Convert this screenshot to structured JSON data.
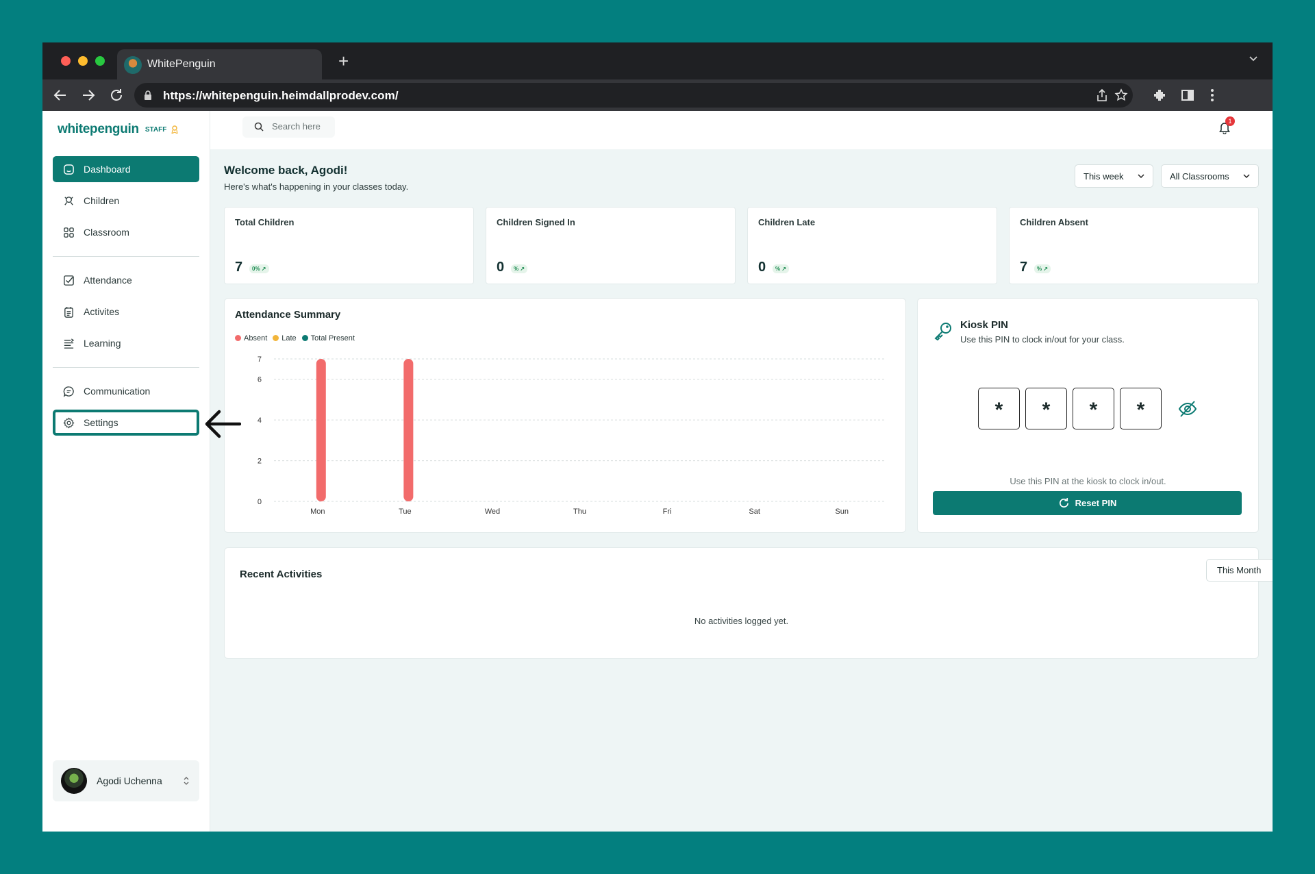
{
  "browser": {
    "tab_title": "WhitePenguin",
    "url": "https://whitepenguin.heimdallprodev.com/"
  },
  "sidebar": {
    "logo": "whitepenguin",
    "logo_tag": "STAFF",
    "items": [
      {
        "label": "Dashboard"
      },
      {
        "label": "Children"
      },
      {
        "label": "Classroom"
      },
      {
        "label": "Attendance"
      },
      {
        "label": "Activites"
      },
      {
        "label": "Learning"
      },
      {
        "label": "Communication"
      },
      {
        "label": "Settings"
      }
    ],
    "user_name": "Agodi Uchenna"
  },
  "header": {
    "search_placeholder": "Search here",
    "notification_count": "1"
  },
  "main": {
    "welcome": "Welcome back, Agodi!",
    "subtitle": "Here's what's happening in your classes today.",
    "period_select": "This week",
    "classroom_select": "All Classrooms",
    "stats": [
      {
        "label": "Total Children",
        "value": "7",
        "change": "0% ↗"
      },
      {
        "label": "Children Signed In",
        "value": "0",
        "change": "% ↗"
      },
      {
        "label": "Children Late",
        "value": "0",
        "change": "% ↗"
      },
      {
        "label": "Children Absent",
        "value": "7",
        "change": "% ↗"
      }
    ],
    "kiosk": {
      "title": "Kiosk PIN",
      "subtitle": "Use this PIN to clock in/out for your class.",
      "pin_digits": [
        "*",
        "*",
        "*",
        "*"
      ],
      "hint": "Use this PIN at the kiosk to clock in/out.",
      "reset_label": "Reset PIN"
    },
    "recent": {
      "title": "Recent Activities",
      "filter": "This Month",
      "empty": "No activities logged yet."
    }
  },
  "colors": {
    "brand": "#0c7a72",
    "absent": "#f26b6b",
    "late": "#f2b53a",
    "present": "#0c7a72"
  },
  "chart_data": {
    "type": "bar",
    "title": "Attendance Summary",
    "categories": [
      "Mon",
      "Tue",
      "Wed",
      "Thu",
      "Fri",
      "Sat",
      "Sun"
    ],
    "series": [
      {
        "name": "Absent",
        "values": [
          7,
          7,
          0,
          0,
          0,
          0,
          0
        ]
      },
      {
        "name": "Late",
        "values": [
          0,
          0,
          0,
          0,
          0,
          0,
          0
        ]
      },
      {
        "name": "Total Present",
        "values": [
          0,
          0,
          0,
          0,
          0,
          0,
          0
        ]
      }
    ],
    "yticks": [
      0,
      2,
      4,
      6,
      7
    ],
    "ylim": [
      0,
      7
    ],
    "legend_position": "top-left",
    "grid": true
  }
}
